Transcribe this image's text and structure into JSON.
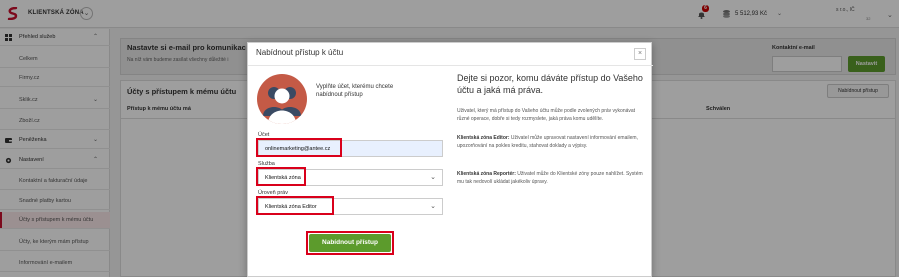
{
  "topbar": {
    "brand": "KLIENTSKÁ ZÓNA",
    "notification_count": "6",
    "credit": "5 512,93 Kč",
    "account_name": "s r.o., IČ",
    "account_sub": "32"
  },
  "sidebar": {
    "items": [
      {
        "label": "Přehled služeb",
        "type": "head",
        "icon": "grid-icon",
        "expanded": true
      },
      {
        "label": "Celkem",
        "type": "sub"
      },
      {
        "label": "Firmy.cz",
        "type": "sub"
      },
      {
        "label": "Sklik.cz",
        "type": "sub",
        "expandable": true
      },
      {
        "label": "Zboží.cz",
        "type": "sub"
      },
      {
        "label": "Peněženka",
        "type": "head",
        "icon": "wallet-icon",
        "expandable": true
      },
      {
        "label": "Nastavení",
        "type": "head",
        "icon": "gear-icon",
        "expanded": true
      },
      {
        "label": "Kontaktní a fakturační údaje",
        "type": "sub"
      },
      {
        "label": "Snadné platby kartou",
        "type": "sub"
      },
      {
        "label": "Účty s přístupem k mému účtu",
        "type": "sub",
        "active": true
      },
      {
        "label": "Účty, ke kterým mám přístup",
        "type": "sub"
      },
      {
        "label": "Informování e-mailem",
        "type": "sub"
      }
    ]
  },
  "main": {
    "email_card": {
      "title": "Nastavte si e-mail pro komunikac",
      "subtitle": "Na níž vám budeme zasílat všechny důležité i",
      "contact_label": "Kontaktní e-mail",
      "save_button": "Nastavit"
    },
    "access_card": {
      "title": "Účty s přístupem k mému účtu",
      "offer_button": "Nabídnout přístup",
      "columns": [
        "Přístup k mému účtu má",
        "Schválen"
      ]
    }
  },
  "modal": {
    "title": "Nabídnout přístup k účtu",
    "close_glyph": "×",
    "intro": "Vyplňte účet, kterému chcete nabídnout přístup",
    "account_label": "Účet",
    "account_value": "onlinemarketing@antee.cz",
    "service_label": "Služba",
    "service_value": "Klientská zóna",
    "role_label": "Úroveň práv",
    "role_value": "Klientská zóna Editor",
    "submit_button": "Nabídnout přístup",
    "right_title": "Dejte si pozor, komu dáváte přístup do Vašeho účtu a jaká má práva.",
    "right_p1": "Uživatel, který má přístup do Vašeho účtu může podle zvolených práv vykonávat různé operace, dobře si tedy rozmyslete, jaká práva komu udělíte.",
    "editor_label": "Klientská zóna Editor:",
    "editor_text": "Uživatel může upravovat nastavení informování emailem, upozorňování na pokles kreditu, stahovat doklady a výpisy.",
    "reporter_label": "Klientská zóna Reportér:",
    "reporter_text": "Uživatel může do Klientské zóny pouze nahlížet. Systém mu tak nedovolí ukládat jakékoliv úpravy."
  },
  "colors": {
    "accent_green": "#5c9b2c",
    "highlight_red": "#d9001b",
    "brand_red": "#c8102e",
    "avatar_bg": "#c45a46"
  }
}
